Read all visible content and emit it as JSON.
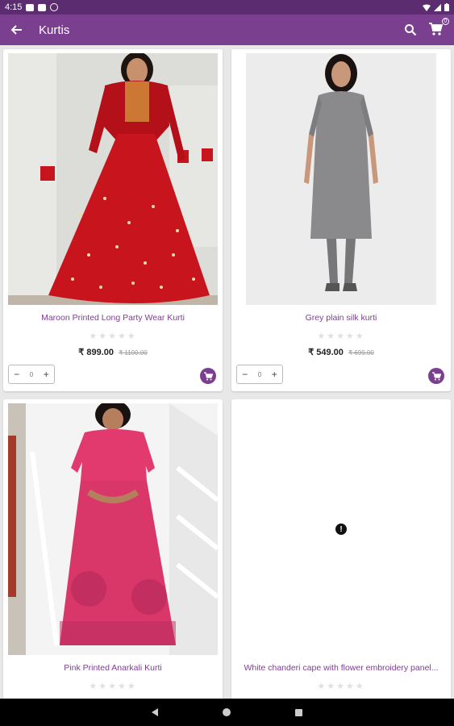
{
  "status_bar": {
    "time": "4:15"
  },
  "app_bar": {
    "title": "Kurtis",
    "cart_count": "0"
  },
  "products": [
    {
      "name": "Maroon Printed Long Party Wear Kurti",
      "price": "₹ 899.00",
      "mrp": "₹ 1100.00",
      "quantity": "0",
      "image_colors": {
        "background": "#dcdcd8",
        "dress": "#c8141c"
      }
    },
    {
      "name": "Grey plain silk kurti",
      "price": "₹ 549.00",
      "mrp": "₹ 699.00",
      "quantity": "0",
      "image_colors": {
        "background": "#ececec",
        "dress": "#8a8a8c"
      }
    },
    {
      "name": "Pink Printed Anarkali Kurti",
      "image_colors": {
        "background": "#f4f4f4",
        "dress": "#e23a6e"
      }
    },
    {
      "name": "White chanderi cape with flower embroidery panel...",
      "image_error_icon": "error-icon"
    }
  ],
  "icons": {
    "back": "back-arrow-icon",
    "search": "search-icon",
    "cart": "cart-icon",
    "add_to_cart": "add-to-cart-icon",
    "rating_star": "star-icon"
  },
  "colors": {
    "primary": "#7b3f8f",
    "status_bar": "#5b2c6f"
  }
}
